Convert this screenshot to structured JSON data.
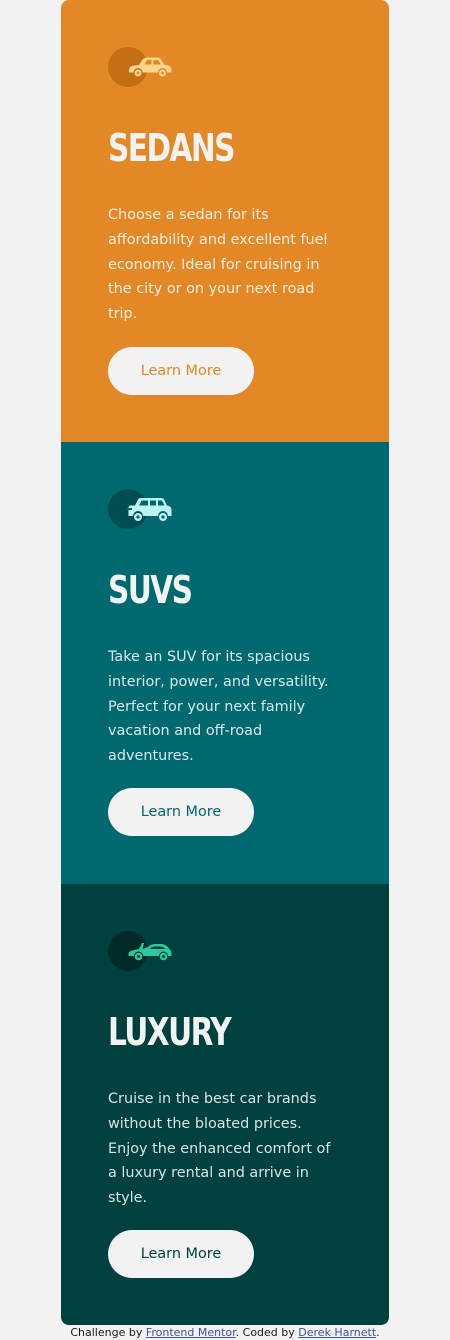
{
  "colors": {
    "sedans_bg": "#e38826",
    "suvs_bg": "#006970",
    "luxury_bg": "#004140",
    "button_bg": "#f2f2f2",
    "sedans_icon_circle": "#c46f14",
    "suvs_icon_circle": "#004d52",
    "luxury_icon_circle": "#002b2a",
    "sedans_icon": "#fcd58c",
    "suvs_icon": "#bff1f1",
    "luxury_icon": "#2fc7a0",
    "footer_link": "#3e52a3"
  },
  "cards": [
    {
      "icon": "sedan-car-icon",
      "title": "SEDANS",
      "description": "Choose a sedan for its affordability and excellent fuel economy. Ideal for cruising in the city or on your next road trip.",
      "button_label": "Learn More"
    },
    {
      "icon": "suv-car-icon",
      "title": "SUVS",
      "description": "Take an SUV for its spacious interior, power, and versatility. Perfect for your next family vacation and off-road adventures.",
      "button_label": "Learn More"
    },
    {
      "icon": "luxury-car-icon",
      "title": "LUXURY",
      "description": "Cruise in the best car brands without the bloated prices. Enjoy the enhanced comfort of a luxury rental and arrive in style.",
      "button_label": "Learn More"
    }
  ],
  "footer": {
    "prefix": "Challenge by ",
    "link1": "Frontend Mentor",
    "middle": ". Coded by ",
    "link2": "Derek Harnett",
    "suffix": "."
  }
}
